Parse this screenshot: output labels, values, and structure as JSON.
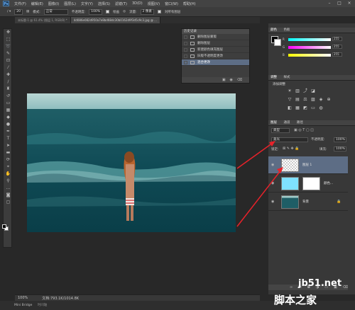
{
  "app": {
    "logo": "Ps"
  },
  "menu": [
    "文件(F)",
    "编辑(E)",
    "图像(I)",
    "图层(L)",
    "文字(Y)",
    "选择(S)",
    "滤镜(T)",
    "3D(D)",
    "视图(V)",
    "窗口(W)",
    "帮助(H)"
  ],
  "options": {
    "brush_size": "20",
    "mode_label": "模式:",
    "mode_value": "正常",
    "opacity_label": "不透明度:",
    "opacity_value": "100%",
    "smooth_label": "绘画",
    "flow_label": "流量:",
    "flow_value": "2 像素",
    "auto_label": "对所有图层"
  },
  "tabs": [
    "未标题-1 @ 61.4% (图层 1, RGB/8) *",
    "4d086e082d950a7e8bd68dc30b0162d9f3d5c9c3.jpg @ ..."
  ],
  "history": {
    "title": "历史记录",
    "items": [
      {
        "label": "删除图层蒙版",
        "selected": false
      },
      {
        "label": "删除图层",
        "selected": false
      },
      {
        "label": "新建颜色填充图层",
        "selected": false
      },
      {
        "label": "旧版不透明度更改",
        "selected": false
      },
      {
        "label": "混合更改",
        "selected": true
      }
    ]
  },
  "color_panel": {
    "tabs": [
      "颜色",
      "色板"
    ],
    "sliders": [
      {
        "label": "R",
        "value": "255",
        "gradient": "#ff00ff"
      },
      {
        "label": "G",
        "value": "255",
        "gradient": "#ff00ff"
      },
      {
        "label": "B",
        "value": "255",
        "gradient": "#ffff00"
      }
    ]
  },
  "adjust_panel": {
    "tabs": [
      "调整",
      "样式"
    ],
    "label": "添加调整"
  },
  "layers_panel": {
    "tabs": [
      "图层",
      "通道",
      "路径"
    ],
    "kind_label": "类型",
    "blend_mode": "柔光",
    "opacity_label": "不透明度:",
    "opacity_value": "100%",
    "lock_label": "锁定:",
    "fill_label": "填充:",
    "fill_value": "100%",
    "layers": [
      {
        "name": "图层 1",
        "selected": true
      },
      {
        "name": "颜色...",
        "selected": false
      },
      {
        "name": "背景",
        "selected": false
      }
    ]
  },
  "status": {
    "zoom": "100%",
    "doc": "文档:793.1K/1014.8K"
  },
  "bottom": {
    "mini_bridge": "Mini Bridge",
    "timeline": "时间轴"
  },
  "watermark": {
    "line1": "jb51.net",
    "line2": "脚本之家"
  },
  "colors": {
    "panel_bg": "#383838",
    "selection": "#5d6d85",
    "arrow": "#e8222a"
  }
}
